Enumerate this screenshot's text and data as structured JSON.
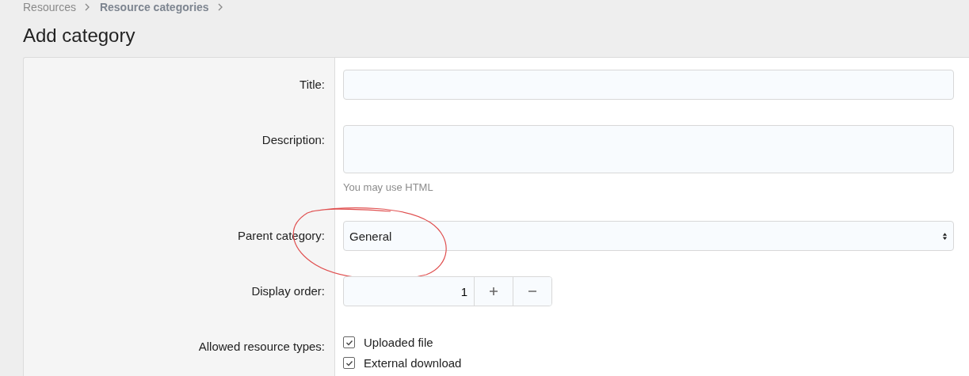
{
  "breadcrumb": [
    {
      "label": "Resources",
      "current": false
    },
    {
      "label": "Resource categories",
      "current": true
    }
  ],
  "page_title": "Add category",
  "form": [
    {
      "kind": "text",
      "label": "Title:"
    },
    {
      "kind": "textarea",
      "label": "Description:",
      "hint": "You may use HTML"
    },
    {
      "kind": "select",
      "label": "Parent category:",
      "value": "General"
    },
    {
      "kind": "spinner",
      "label": "Display order:",
      "value": "1"
    },
    {
      "kind": "checkboxes",
      "label": "Allowed resource types:",
      "options": [
        {
          "label": "Uploaded file",
          "checked": true
        },
        {
          "label": "External download",
          "checked": true
        }
      ]
    }
  ],
  "annotation": {
    "kind": "circle"
  }
}
